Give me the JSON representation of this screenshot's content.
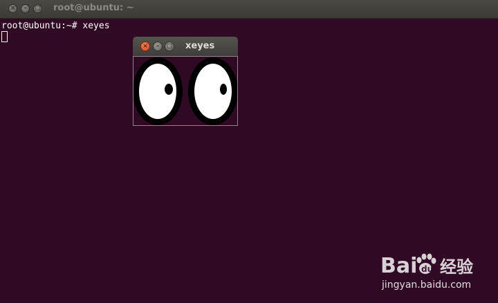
{
  "terminal": {
    "title": "root@ubuntu: ~",
    "prompt_line": "root@ubuntu:~# xeyes"
  },
  "xeyes_window": {
    "title": "xeyes"
  },
  "watermark": {
    "brand": "Bai经验",
    "url": "jingyan.baidu.com"
  },
  "colors": {
    "terminal_bg": "#300a24",
    "close_button": "#e35b2e"
  },
  "icons": [
    "close-icon",
    "minimize-icon",
    "maximize-icon",
    "baidu-paw-icon"
  ]
}
